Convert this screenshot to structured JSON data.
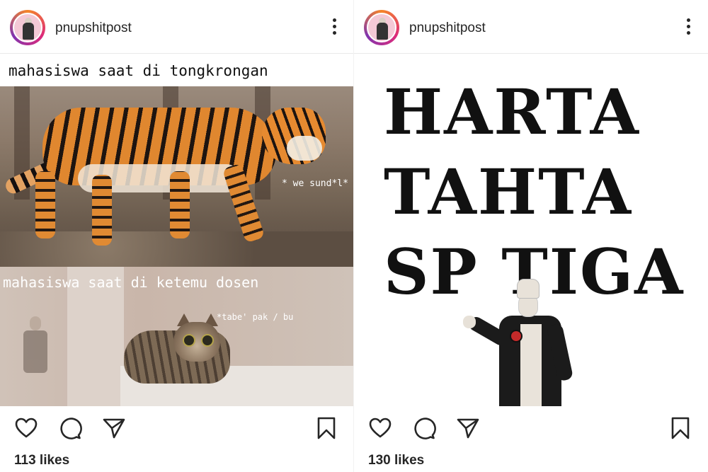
{
  "posts": [
    {
      "username": "pnupshitpost",
      "caption_top": "mahasiswa saat di tongkrongan",
      "overlay_top": "* we sund*l*",
      "caption_mid": "mahasiswa saat di ketemu dosen",
      "overlay_mid": "*tabe' pak / bu",
      "likes": "113 likes",
      "icons": [
        "heart-icon",
        "comment-icon",
        "share-icon",
        "bookmark-icon"
      ]
    },
    {
      "username": "pnupshitpost",
      "line1": "HARTA",
      "line2": "TAHTA",
      "line3": "SP TIGA",
      "likes": "130 likes",
      "icons": [
        "heart-icon",
        "comment-icon",
        "share-icon",
        "bookmark-icon"
      ]
    }
  ],
  "colors": {
    "text": "#262626",
    "background": "#ffffff",
    "avatar_ring": "#dd2a7b"
  }
}
